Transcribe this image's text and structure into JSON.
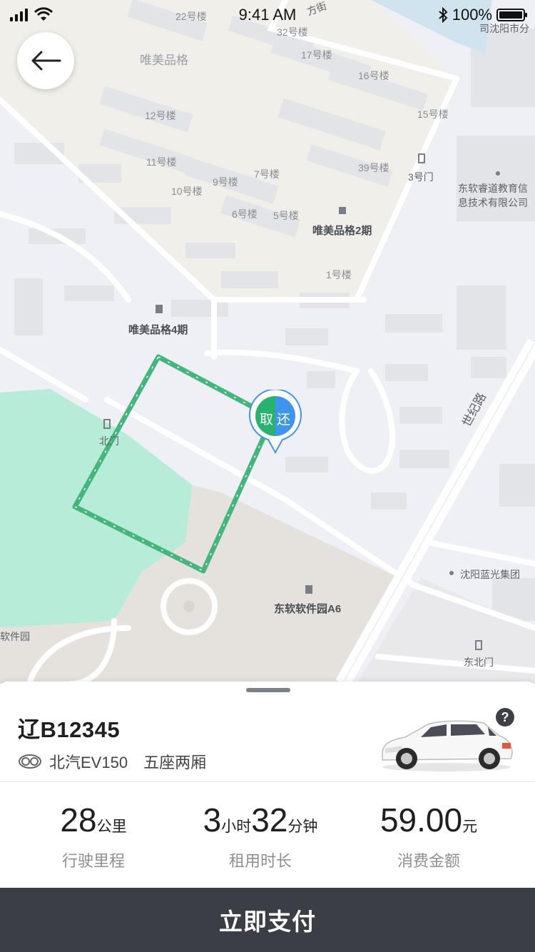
{
  "status_bar": {
    "time": "9:41 AM",
    "battery": "100%"
  },
  "map": {
    "labels": [
      "22号楼",
      "32号楼",
      "方街",
      "唯美品格",
      "17号楼",
      "16号楼",
      "15号楼",
      "12号楼",
      "11号楼",
      "9号楼",
      "7号楼",
      "39号楼",
      "3号门",
      "10号楼",
      "6号楼",
      "5号楼",
      "唯美品格2期",
      "1号楼",
      "东软睿道教育信息技术有限公司",
      "司沈阳市分",
      "唯美品格4期",
      "北门",
      "世纪路",
      "沈阳蓝光集团",
      "东软软件园A6",
      "软件园",
      "东北门"
    ],
    "pin": {
      "pickup": "取",
      "return": "还"
    }
  },
  "sheet": {
    "plate": "辽B12345",
    "model": "北汽EV150",
    "seats": "五座两厢",
    "help": "?",
    "stats": [
      {
        "value": "28",
        "unit": "公里",
        "label": "行驶里程"
      },
      {
        "value_h": "3",
        "unit_h": "小时",
        "value_m": "32",
        "unit_m": "分钟",
        "label": "租用时长"
      },
      {
        "value": "59.00",
        "unit": "元",
        "label": "消费金额"
      }
    ]
  },
  "pay_button": "立即支付",
  "colors": {
    "route": "#43b67b",
    "pickup": "#27b36d",
    "return": "#3d95ee",
    "park": "#b7ecd9",
    "button": "#3b3e44"
  }
}
